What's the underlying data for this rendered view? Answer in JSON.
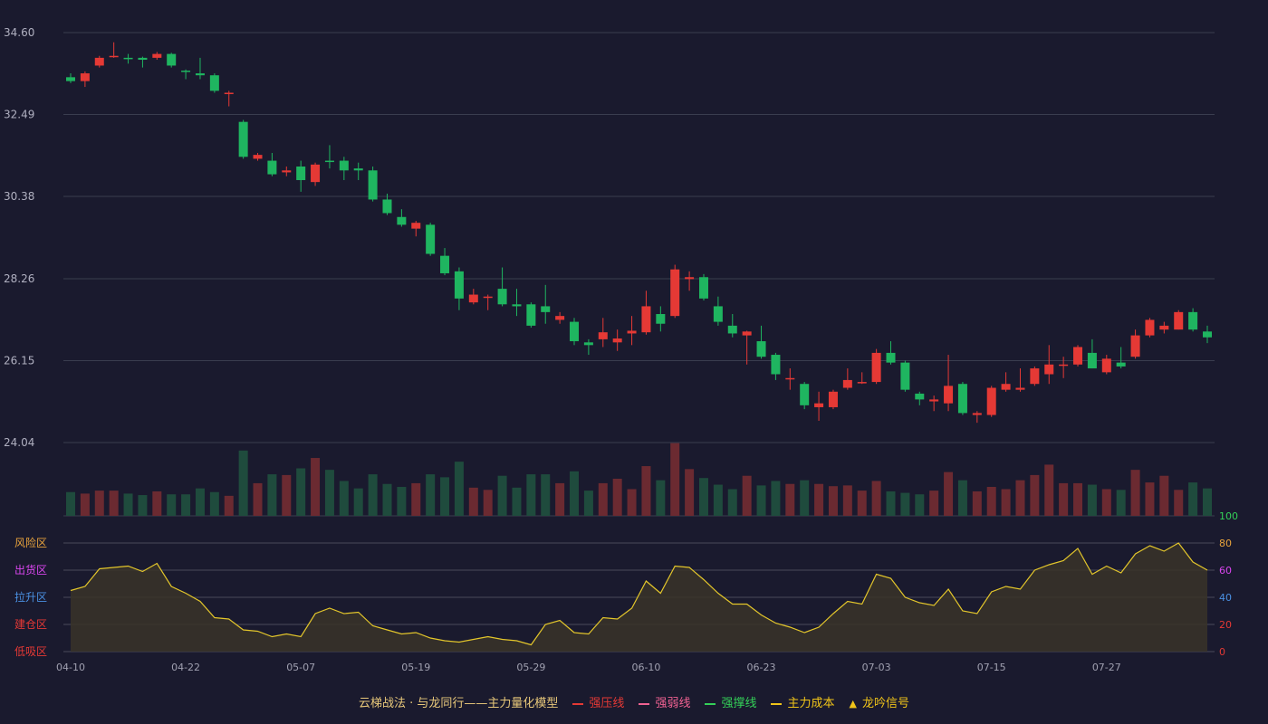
{
  "chart_data": {
    "type": "candlestick",
    "price_axis": {
      "ticks": [
        "34.60",
        "32.49",
        "30.38",
        "28.26",
        "26.15",
        "24.04"
      ],
      "ylim": [
        24.04,
        34.6
      ]
    },
    "x_axis": {
      "tick_labels": [
        "04-10",
        "04-22",
        "05-07",
        "05-19",
        "05-29",
        "06-10",
        "06-23",
        "07-03",
        "07-15",
        "07-27"
      ],
      "tick_index": [
        0,
        8,
        16,
        24,
        32,
        40,
        48,
        56,
        64,
        72
      ]
    },
    "candles": [
      [
        33.45,
        33.35,
        33.55,
        33.3
      ],
      [
        33.35,
        33.55,
        33.6,
        33.2
      ],
      [
        33.75,
        33.95,
        34.0,
        33.7
      ],
      [
        33.98,
        34.0,
        34.35,
        33.95
      ],
      [
        33.95,
        33.93,
        34.05,
        33.8
      ],
      [
        33.95,
        33.9,
        33.98,
        33.7
      ],
      [
        33.95,
        34.05,
        34.1,
        33.9
      ],
      [
        34.05,
        33.75,
        34.08,
        33.7
      ],
      [
        33.62,
        33.6,
        33.65,
        33.4
      ],
      [
        33.55,
        33.5,
        33.95,
        33.4
      ],
      [
        33.5,
        33.1,
        33.55,
        33.05
      ],
      [
        33.05,
        33.05,
        33.1,
        32.7
      ],
      [
        32.3,
        31.4,
        32.35,
        31.35
      ],
      [
        31.35,
        31.45,
        31.5,
        31.3
      ],
      [
        31.3,
        30.95,
        31.5,
        30.9
      ],
      [
        31.0,
        31.05,
        31.15,
        30.9
      ],
      [
        31.15,
        30.8,
        31.3,
        30.5
      ],
      [
        30.75,
        31.2,
        31.25,
        30.65
      ],
      [
        31.3,
        31.27,
        31.7,
        31.1
      ],
      [
        31.3,
        31.05,
        31.4,
        30.8
      ],
      [
        31.1,
        31.05,
        31.25,
        30.8
      ],
      [
        31.05,
        30.3,
        31.15,
        30.25
      ],
      [
        30.3,
        29.95,
        30.45,
        29.9
      ],
      [
        29.85,
        29.65,
        30.05,
        29.6
      ],
      [
        29.55,
        29.7,
        29.75,
        29.35
      ],
      [
        29.65,
        28.9,
        29.7,
        28.85
      ],
      [
        28.85,
        28.4,
        29.05,
        28.35
      ],
      [
        28.45,
        27.75,
        28.55,
        27.45
      ],
      [
        27.65,
        27.85,
        28.0,
        27.6
      ],
      [
        27.8,
        27.8,
        27.85,
        27.45
      ],
      [
        28.0,
        27.6,
        28.55,
        27.55
      ],
      [
        27.6,
        27.55,
        28.0,
        27.3
      ],
      [
        27.6,
        27.05,
        27.65,
        27.0
      ],
      [
        27.55,
        27.4,
        28.1,
        27.1
      ],
      [
        27.2,
        27.3,
        27.4,
        27.1
      ],
      [
        27.15,
        26.65,
        27.25,
        26.55
      ],
      [
        26.62,
        26.55,
        26.7,
        26.3
      ],
      [
        26.7,
        26.88,
        27.25,
        26.5
      ],
      [
        26.62,
        26.72,
        26.95,
        26.4
      ],
      [
        26.85,
        26.92,
        27.3,
        26.55
      ],
      [
        26.88,
        27.55,
        27.95,
        26.82
      ],
      [
        27.35,
        27.1,
        27.55,
        26.9
      ],
      [
        27.3,
        28.5,
        28.62,
        27.25
      ],
      [
        28.25,
        28.3,
        28.45,
        27.95
      ],
      [
        28.3,
        27.75,
        28.38,
        27.7
      ],
      [
        27.55,
        27.15,
        27.8,
        27.05
      ],
      [
        27.05,
        26.85,
        27.35,
        26.75
      ],
      [
        26.8,
        26.9,
        26.92,
        26.05
      ],
      [
        26.65,
        26.25,
        27.05,
        26.2
      ],
      [
        26.3,
        25.8,
        26.35,
        25.65
      ],
      [
        25.7,
        25.7,
        25.95,
        25.4
      ],
      [
        25.55,
        25.0,
        25.6,
        24.9
      ],
      [
        24.95,
        25.05,
        25.35,
        24.6
      ],
      [
        24.95,
        25.35,
        25.4,
        24.9
      ],
      [
        25.45,
        25.65,
        25.95,
        25.4
      ],
      [
        25.6,
        25.6,
        25.85,
        25.55
      ],
      [
        25.6,
        26.35,
        26.45,
        25.55
      ],
      [
        26.35,
        26.1,
        26.65,
        26.05
      ],
      [
        26.1,
        25.4,
        26.15,
        25.35
      ],
      [
        25.3,
        25.15,
        25.35,
        25.0
      ],
      [
        25.1,
        25.15,
        25.25,
        24.85
      ],
      [
        25.05,
        25.5,
        26.3,
        24.85
      ],
      [
        25.55,
        24.8,
        25.6,
        24.75
      ],
      [
        24.75,
        24.8,
        24.85,
        24.55
      ],
      [
        24.75,
        25.45,
        25.5,
        24.7
      ],
      [
        25.4,
        25.55,
        25.85,
        25.35
      ],
      [
        25.4,
        25.45,
        25.95,
        25.35
      ],
      [
        25.55,
        25.95,
        26.0,
        25.5
      ],
      [
        25.8,
        26.05,
        26.55,
        25.55
      ],
      [
        26.05,
        26.05,
        26.25,
        25.7
      ],
      [
        26.05,
        26.5,
        26.55,
        26.0
      ],
      [
        26.35,
        25.95,
        26.7,
        25.95
      ],
      [
        25.85,
        26.2,
        26.3,
        25.8
      ],
      [
        26.1,
        26.0,
        26.5,
        25.95
      ],
      [
        26.25,
        26.8,
        26.95,
        26.2
      ],
      [
        26.8,
        27.2,
        27.25,
        26.75
      ],
      [
        26.95,
        27.05,
        27.15,
        26.85
      ],
      [
        26.95,
        27.4,
        27.45,
        26.95
      ],
      [
        27.4,
        26.95,
        27.5,
        26.9
      ],
      [
        26.9,
        26.75,
        27.05,
        26.6
      ]
    ],
    "volume": [
      0.32,
      0.3,
      0.34,
      0.34,
      0.3,
      0.28,
      0.33,
      0.29,
      0.29,
      0.37,
      0.32,
      0.27,
      0.88,
      0.44,
      0.56,
      0.55,
      0.64,
      0.78,
      0.62,
      0.47,
      0.37,
      0.56,
      0.43,
      0.39,
      0.44,
      0.56,
      0.52,
      0.73,
      0.38,
      0.35,
      0.54,
      0.38,
      0.56,
      0.56,
      0.44,
      0.6,
      0.34,
      0.44,
      0.5,
      0.36,
      0.67,
      0.48,
      0.98,
      0.63,
      0.51,
      0.42,
      0.36,
      0.54,
      0.41,
      0.47,
      0.43,
      0.48,
      0.43,
      0.4,
      0.41,
      0.34,
      0.47,
      0.33,
      0.31,
      0.29,
      0.34,
      0.59,
      0.48,
      0.33,
      0.39,
      0.36,
      0.48,
      0.55,
      0.69,
      0.44,
      0.44,
      0.42,
      0.36,
      0.35,
      0.62,
      0.45,
      0.54,
      0.35,
      0.45,
      0.37
    ],
    "oscillator": {
      "axis_ticks": [
        "0",
        "20",
        "40",
        "60",
        "80",
        "100"
      ],
      "axis_tick_colors": [
        "#e53935",
        "#e53935",
        "#4a90e2",
        "#d946ef",
        "#e8a33c",
        "#34d058"
      ],
      "zones": [
        {
          "label": "风险区",
          "value": 80,
          "color": "#e8a33c"
        },
        {
          "label": "出货区",
          "value": 60,
          "color": "#d946ef"
        },
        {
          "label": "拉升区",
          "value": 40,
          "color": "#4a90e2"
        },
        {
          "label": "建仓区",
          "value": 20,
          "color": "#e53935"
        },
        {
          "label": "低吸区",
          "value": 0,
          "color": "#e53935"
        }
      ],
      "values": [
        45,
        48,
        61,
        62,
        63,
        59,
        65,
        48,
        43,
        37,
        25,
        24,
        16,
        15,
        11,
        13,
        11,
        28,
        32,
        28,
        29,
        19,
        16,
        13,
        14,
        10,
        8,
        7,
        9,
        11,
        9,
        8,
        5,
        20,
        23,
        14,
        13,
        25,
        24,
        32,
        52,
        43,
        63,
        62,
        53,
        43,
        35,
        35,
        27,
        21,
        18,
        14,
        18,
        28,
        37,
        35,
        57,
        54,
        40,
        36,
        34,
        46,
        30,
        28,
        44,
        48,
        46,
        60,
        64,
        67,
        76,
        57,
        63,
        58,
        72,
        78,
        74,
        80,
        66,
        60
      ]
    },
    "legend": [
      {
        "label": "云梯战法 · 与龙同行——主力量化模型",
        "marker": "none",
        "color": "#e8c87a"
      },
      {
        "label": "强压线",
        "marker": "solid",
        "color": "#e53935"
      },
      {
        "label": "强弱线",
        "marker": "dashed",
        "color": "#f06292"
      },
      {
        "label": "强撑线",
        "marker": "solid",
        "color": "#34d058"
      },
      {
        "label": "主力成本",
        "marker": "dashed",
        "color": "#f0c419"
      },
      {
        "label": "龙吟信号",
        "marker": "triangle",
        "color": "#f0c419"
      }
    ]
  },
  "colors": {
    "up": "#e53935",
    "down": "#1fb560",
    "vol_up": "#6b2a31",
    "vol_down": "#1f4b3d",
    "osc_line": "#e3c62b",
    "bg": "#1a1a2e"
  }
}
